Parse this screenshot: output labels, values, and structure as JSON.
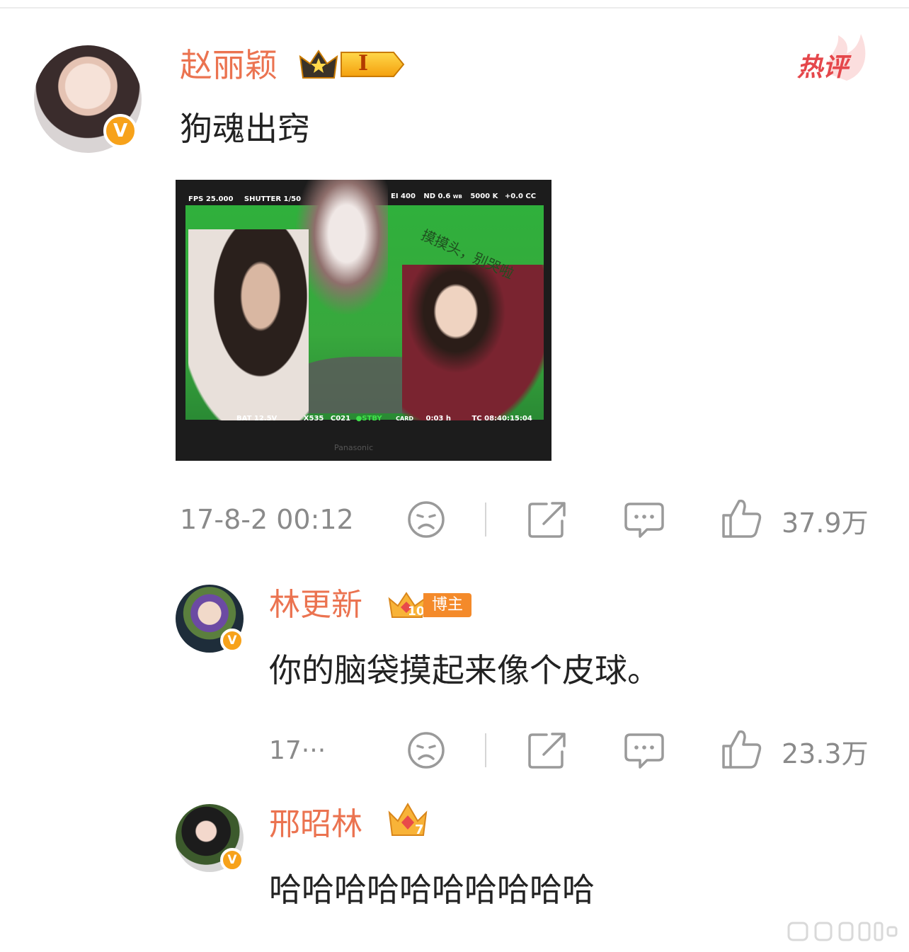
{
  "post": {
    "author": "赵丽颖",
    "level_badge": "I",
    "hot_tag": "热评",
    "text": "狗魂出窍",
    "photo": {
      "hud_fps": "FPS 25.000",
      "hud_shutter": "SHUTTER 1/50",
      "hud_ei": "EI 400",
      "hud_nd": "ND 0.6",
      "hud_wb": "WB",
      "hud_kelvin": "5000 K",
      "hud_cc": "+0.0 CC",
      "hud_bat": "BAT 12.5V",
      "hud_x": "X535",
      "hud_clip": "C021",
      "hud_stby": "●STBY",
      "hud_card": "CARD",
      "hud_time": "0:03 h",
      "hud_tc": "TC 08:40:15:04",
      "caption": "摸摸头，别哭啦",
      "brand": "Panasonic"
    },
    "timestamp": "17-8-2 00:12",
    "likes": "37.9万"
  },
  "replies": [
    {
      "author": "林更新",
      "badge_level": "10",
      "badge_label": "博主",
      "text": "你的脑袋摸起来像个皮球。",
      "timestamp": "17···",
      "likes": "23.3万"
    },
    {
      "author": "邢昭林",
      "badge_level": "7",
      "text": "哈哈哈哈哈哈哈哈哈哈"
    }
  ],
  "colors": {
    "name": "#eb7350",
    "icon": "#9a9a9a",
    "verified": "#f7a21a",
    "hot": "#e5474b"
  },
  "icons": [
    "dislike-face-icon",
    "share-icon",
    "comment-icon",
    "thumbs-up-icon",
    "verified-v-icon",
    "crown-icon"
  ]
}
